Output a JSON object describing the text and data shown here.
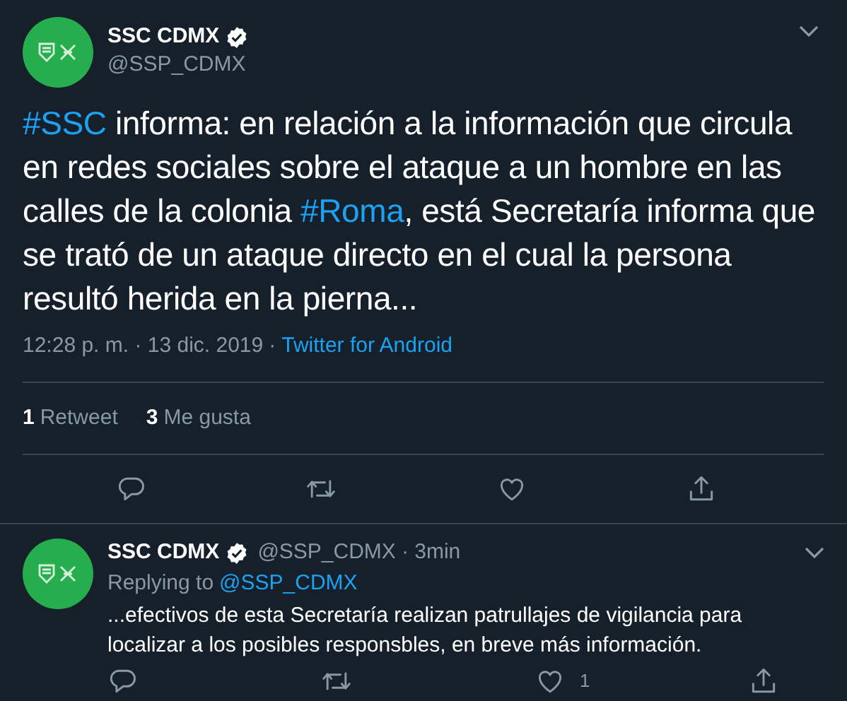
{
  "tweet": {
    "author": {
      "name": "SSC CDMX",
      "handle": "@SSP_CDMX",
      "verified": true
    },
    "text": [
      {
        "kind": "hashtag",
        "text": "#SSC"
      },
      {
        "kind": "plain",
        "text": " informa: en relación a la información que circula en redes sociales sobre el ataque a un hombre en las calles de la colonia "
      },
      {
        "kind": "hashtag",
        "text": "#Roma"
      },
      {
        "kind": "plain",
        "text": ", está Secretaría informa que se trató de un ataque directo en el cual la persona resultó herida en la pierna..."
      }
    ],
    "timestamp": "12:28 p. m. · 13 dic. 2019",
    "separator": "·",
    "source": "Twitter for Android",
    "stats": [
      {
        "count": "1",
        "label": "Retweet"
      },
      {
        "count": "3",
        "label": "Me gusta"
      }
    ],
    "actions": [
      {
        "kind": "reply"
      },
      {
        "kind": "retweet"
      },
      {
        "kind": "like"
      },
      {
        "kind": "share"
      }
    ]
  },
  "reply": {
    "author": {
      "name": "SSC CDMX",
      "handle": "@SSP_CDMX",
      "verified": true
    },
    "age": "· 3min",
    "replying_to": "Replying to",
    "mention": "@SSP_CDMX",
    "text": "...efectivos de esta Secretaría realizan patrullajes de vigilancia para localizar a los posibles responsbles, en breve más información.",
    "actions": [
      {
        "kind": "reply"
      },
      {
        "kind": "retweet"
      },
      {
        "kind": "like",
        "count": "1"
      },
      {
        "kind": "share"
      }
    ]
  }
}
